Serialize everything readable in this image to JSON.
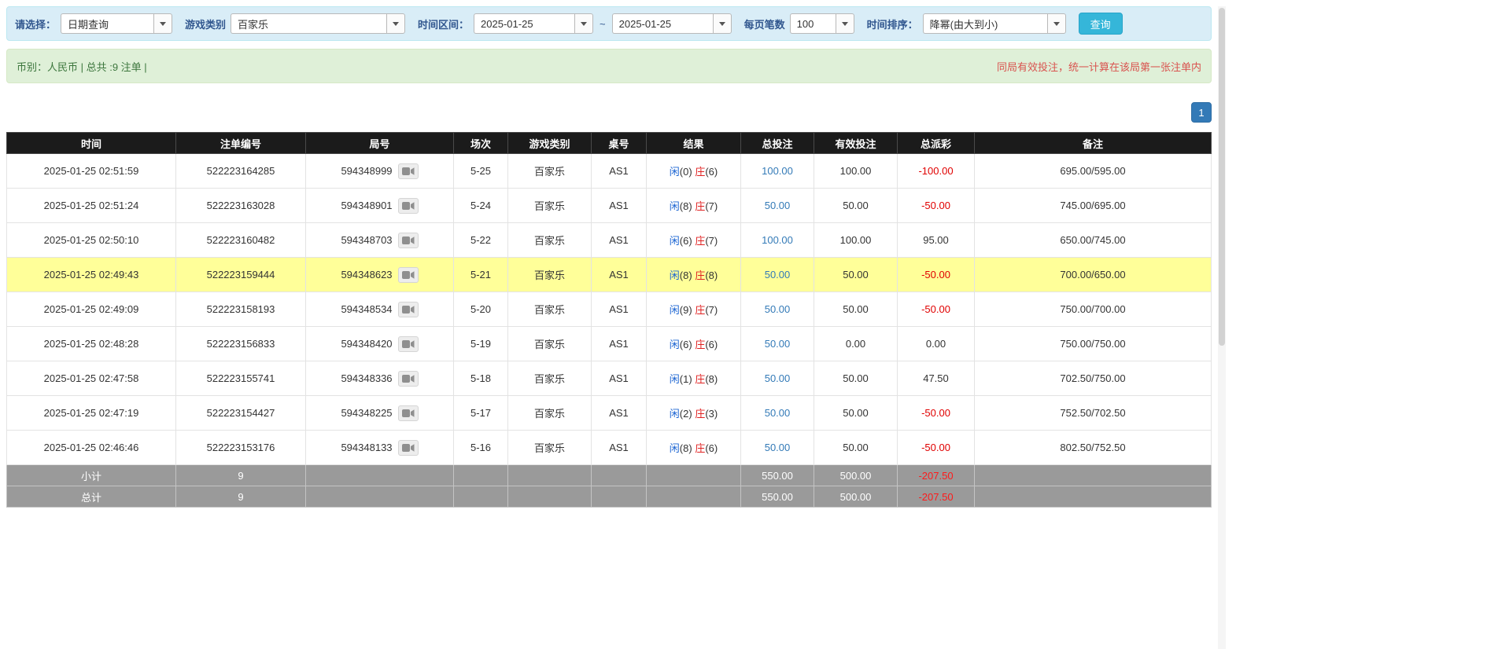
{
  "filters": {
    "select_label": "请选择：",
    "select_value": "日期查询",
    "game_label": "游戏类别",
    "game_value": "百家乐",
    "range_label": "时间区间：",
    "date_from": "2025-01-25",
    "range_separator": "~",
    "date_to": "2025-01-25",
    "page_size_label": "每页笔数",
    "page_size_value": "100",
    "sort_label": "时间排序：",
    "sort_value": "降幂(由大到小)",
    "query_button": "查询"
  },
  "info_bar": {
    "summary": "币别：人民币 | 总共 :9 注单 |",
    "notice": "同局有效投注，统一计算在该局第一张注单内"
  },
  "pagination": {
    "pages": [
      "1"
    ]
  },
  "icons": {
    "dropdown": "caret-down-icon",
    "round_replay": "video-camera-icon"
  },
  "colors": {
    "accent_blue": "#337ab7",
    "player_blue": "#1b64d2",
    "banker_red": "#e02222",
    "negative_red": "#e00000",
    "highlight_yellow": "#ffff99",
    "header_black": "#1b1b1b",
    "footer_gray": "#9a9a9a",
    "query_button_cyan": "#35b6d9"
  },
  "table": {
    "headers": [
      "时间",
      "注单编号",
      "局号",
      "场次",
      "游戏类别",
      "桌号",
      "结果",
      "总投注",
      "有效投注",
      "总派彩",
      "备注"
    ],
    "rows": [
      {
        "time": "2025-01-25 02:51:59",
        "bet_id": "522223164285",
        "round_id": "594348999",
        "session": "5-25",
        "game": "百家乐",
        "table_no": "AS1",
        "player": "闲",
        "player_score": "(0)",
        "banker": "庄",
        "banker_score": "(6)",
        "total_bet": "100.00",
        "valid_bet": "100.00",
        "payout": "-100.00",
        "remark": "695.00/595.00",
        "highlight": false
      },
      {
        "time": "2025-01-25 02:51:24",
        "bet_id": "522223163028",
        "round_id": "594348901",
        "session": "5-24",
        "game": "百家乐",
        "table_no": "AS1",
        "player": "闲",
        "player_score": "(8)",
        "banker": "庄",
        "banker_score": "(7)",
        "total_bet": "50.00",
        "valid_bet": "50.00",
        "payout": "-50.00",
        "remark": "745.00/695.00",
        "highlight": false
      },
      {
        "time": "2025-01-25 02:50:10",
        "bet_id": "522223160482",
        "round_id": "594348703",
        "session": "5-22",
        "game": "百家乐",
        "table_no": "AS1",
        "player": "闲",
        "player_score": "(6)",
        "banker": "庄",
        "banker_score": "(7)",
        "total_bet": "100.00",
        "valid_bet": "100.00",
        "payout": "95.00",
        "remark": "650.00/745.00",
        "highlight": false
      },
      {
        "time": "2025-01-25 02:49:43",
        "bet_id": "522223159444",
        "round_id": "594348623",
        "session": "5-21",
        "game": "百家乐",
        "table_no": "AS1",
        "player": "闲",
        "player_score": "(8)",
        "banker": "庄",
        "banker_score": "(8)",
        "total_bet": "50.00",
        "valid_bet": "50.00",
        "payout": "-50.00",
        "remark": "700.00/650.00",
        "highlight": true
      },
      {
        "time": "2025-01-25 02:49:09",
        "bet_id": "522223158193",
        "round_id": "594348534",
        "session": "5-20",
        "game": "百家乐",
        "table_no": "AS1",
        "player": "闲",
        "player_score": "(9)",
        "banker": "庄",
        "banker_score": "(7)",
        "total_bet": "50.00",
        "valid_bet": "50.00",
        "payout": "-50.00",
        "remark": "750.00/700.00",
        "highlight": false
      },
      {
        "time": "2025-01-25 02:48:28",
        "bet_id": "522223156833",
        "round_id": "594348420",
        "session": "5-19",
        "game": "百家乐",
        "table_no": "AS1",
        "player": "闲",
        "player_score": "(6)",
        "banker": "庄",
        "banker_score": "(6)",
        "total_bet": "50.00",
        "valid_bet": "0.00",
        "payout": "0.00",
        "remark": "750.00/750.00",
        "highlight": false
      },
      {
        "time": "2025-01-25 02:47:58",
        "bet_id": "522223155741",
        "round_id": "594348336",
        "session": "5-18",
        "game": "百家乐",
        "table_no": "AS1",
        "player": "闲",
        "player_score": "(1)",
        "banker": "庄",
        "banker_score": "(8)",
        "total_bet": "50.00",
        "valid_bet": "50.00",
        "payout": "47.50",
        "remark": "702.50/750.00",
        "highlight": false
      },
      {
        "time": "2025-01-25 02:47:19",
        "bet_id": "522223154427",
        "round_id": "594348225",
        "session": "5-17",
        "game": "百家乐",
        "table_no": "AS1",
        "player": "闲",
        "player_score": "(2)",
        "banker": "庄",
        "banker_score": "(3)",
        "total_bet": "50.00",
        "valid_bet": "50.00",
        "payout": "-50.00",
        "remark": "752.50/702.50",
        "highlight": false
      },
      {
        "time": "2025-01-25 02:46:46",
        "bet_id": "522223153176",
        "round_id": "594348133",
        "session": "5-16",
        "game": "百家乐",
        "table_no": "AS1",
        "player": "闲",
        "player_score": "(8)",
        "banker": "庄",
        "banker_score": "(6)",
        "total_bet": "50.00",
        "valid_bet": "50.00",
        "payout": "-50.00",
        "remark": "802.50/752.50",
        "highlight": false
      }
    ],
    "subtotal": {
      "label": "小计",
      "count": "9",
      "total_bet": "550.00",
      "valid_bet": "500.00",
      "payout": "-207.50"
    },
    "total": {
      "label": "总计",
      "count": "9",
      "total_bet": "550.00",
      "valid_bet": "500.00",
      "payout": "-207.50"
    }
  }
}
